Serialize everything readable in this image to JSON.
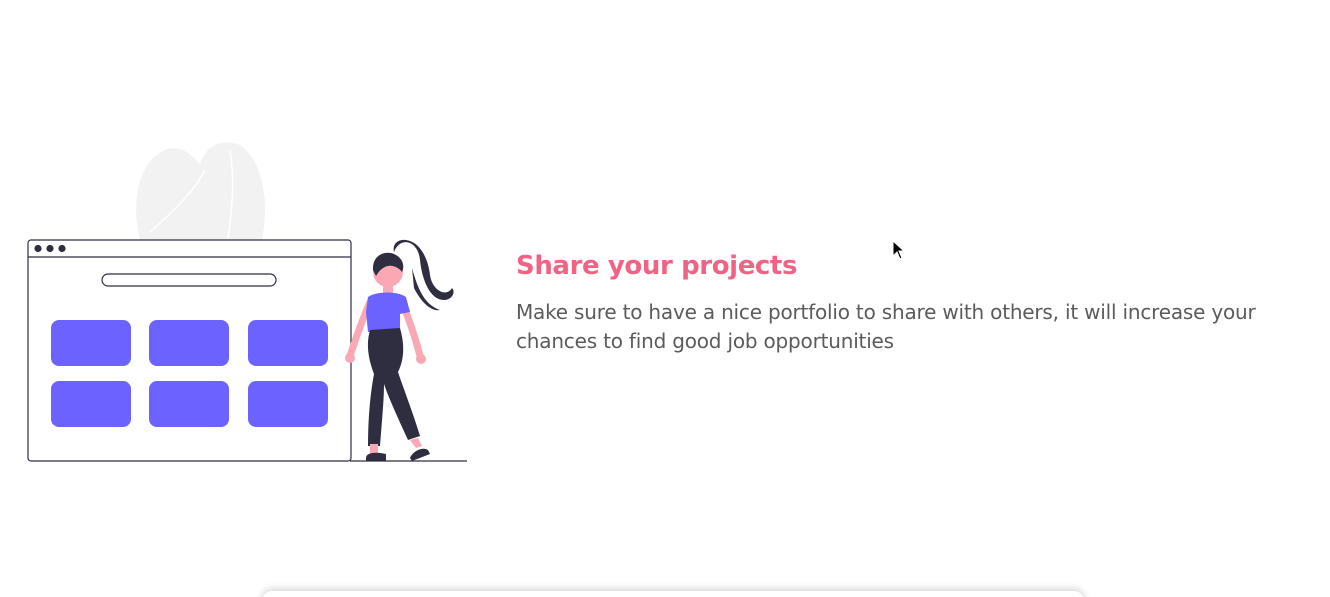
{
  "section": {
    "title": "Share your projects",
    "description": "Make sure to have a nice portfolio to share with others, it will increase your chances to find good job opportunities"
  },
  "illustration": {
    "name": "woman-beside-portfolio-browser",
    "tiles": 6
  },
  "colors": {
    "title": "#f06385",
    "text": "#5b5b5b",
    "accent": "#6c63ff",
    "dark": "#2f2e41",
    "skin": "#f9a8b4",
    "leaf": "#f2f2f2"
  },
  "cursor": {
    "icon": "mouse-pointer-icon"
  }
}
